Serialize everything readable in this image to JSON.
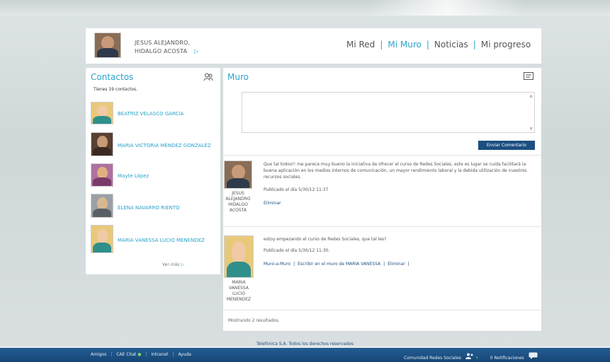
{
  "header": {
    "user_name_line1": "JESUS ALEJANDRO,",
    "user_name_line2": "HIDALGO ACOSTA",
    "nav": [
      "Mi Red",
      "Mi Muro",
      "Noticias",
      "Mi progreso"
    ],
    "nav_separator": "|",
    "active_nav": "Mi Muro",
    "arrow": "▷"
  },
  "contacts": {
    "title": "Contactos",
    "count_text": "Tienes 19 contactos.",
    "items": [
      {
        "name": "BEATRIZ VELASCO GARCIA"
      },
      {
        "name": "MARIA VICTORIA MÉNDEZ GONZALEZ"
      },
      {
        "name": "Mayte López"
      },
      {
        "name": "ELENA NAVARRO RIENTO"
      },
      {
        "name": "MARIA VANESSA LUCIO MENENDEZ"
      }
    ],
    "ver_mas": "Ver más",
    "ver_mas_arrow": "▷"
  },
  "muro": {
    "title": "Muro",
    "send_button": "Enviar Comentario",
    "scroll_up": "▲",
    "scroll_down": "▼",
    "posts": [
      {
        "author_lines": [
          "JESUS",
          "ALEJANDRO",
          "HIDALGO",
          "ACOSTA"
        ],
        "text": "Que tal todos!! me parece muy bueno la iniciativa de ofrecer el curso de Redes Sociales, este es lugar se cuida facilitará la buena aplicación en los medios internos de comunicación, un mayor rendimiento laboral y la debida utilización de nuestros recursos sociales.",
        "meta": "Publicado el día 5/30/12 11:37",
        "actions": [
          "Eliminar"
        ]
      },
      {
        "author_lines": [
          "MARIA",
          "VANESSA",
          "LUCIO",
          "MENENDEZ"
        ],
        "text": "estoy empezando el curso de Redes Sociales, que tal les?",
        "meta": "Publicado el día 5/30/12 11:30.",
        "actions": [
          "Muro-a-Muro",
          "Escribir en el muro de MARIA VANESSA",
          "Eliminar"
        ],
        "trailing_separator": "|"
      }
    ],
    "results_text": "Mostrando 2 resultados."
  },
  "copyright": "Telefónica S.A. Todos los derechos reservados",
  "footer": {
    "left_items": [
      "Amigos",
      "CAE Chat",
      "Intranet",
      "Ayuda"
    ],
    "chat_status_dot": "●",
    "right_text": "Comunidad Redes Sociales",
    "plus": "+",
    "notifications_text": "0 Notificaciones"
  },
  "colors": {
    "accent": "#2aa3c9",
    "button": "#1c4f80",
    "footer": "#1a4f82"
  }
}
